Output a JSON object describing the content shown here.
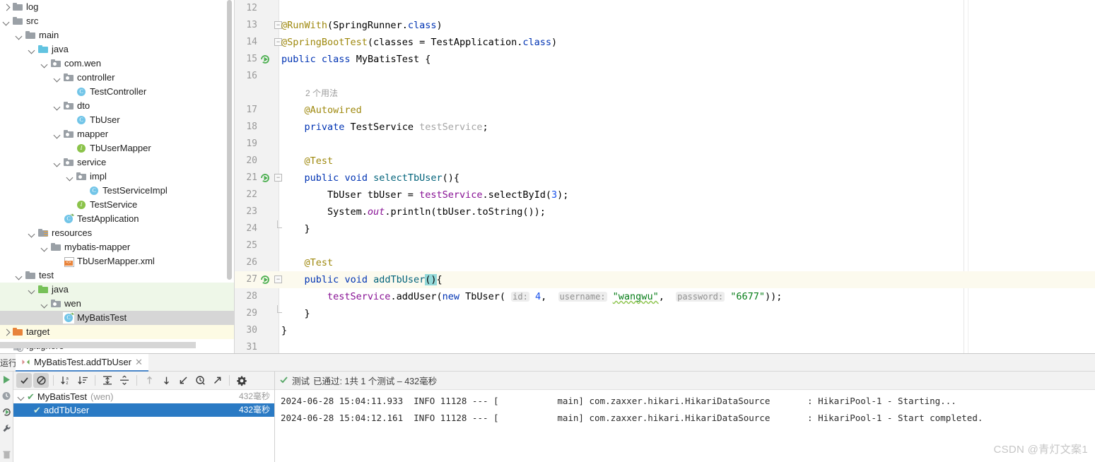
{
  "project_tree": {
    "items": [
      {
        "label": "log",
        "indent": 0,
        "twisty": "right",
        "icon": "folder",
        "tint": "none"
      },
      {
        "label": "src",
        "indent": 0,
        "twisty": "down",
        "icon": "folder",
        "tint": "none"
      },
      {
        "label": "main",
        "indent": 1,
        "twisty": "down",
        "icon": "folder",
        "tint": "none"
      },
      {
        "label": "java",
        "indent": 2,
        "twisty": "down",
        "icon": "folder-blue",
        "tint": "none"
      },
      {
        "label": "com.wen",
        "indent": 3,
        "twisty": "down",
        "icon": "pkg",
        "tint": "none"
      },
      {
        "label": "controller",
        "indent": 4,
        "twisty": "down",
        "icon": "pkg",
        "tint": "none"
      },
      {
        "label": "TestController",
        "indent": 5,
        "twisty": "none",
        "icon": "class",
        "tint": "none"
      },
      {
        "label": "dto",
        "indent": 4,
        "twisty": "down",
        "icon": "pkg",
        "tint": "none"
      },
      {
        "label": "TbUser",
        "indent": 5,
        "twisty": "none",
        "icon": "class",
        "tint": "none"
      },
      {
        "label": "mapper",
        "indent": 4,
        "twisty": "down",
        "icon": "pkg",
        "tint": "none"
      },
      {
        "label": "TbUserMapper",
        "indent": 5,
        "twisty": "none",
        "icon": "interface",
        "tint": "none"
      },
      {
        "label": "service",
        "indent": 4,
        "twisty": "down",
        "icon": "pkg",
        "tint": "none"
      },
      {
        "label": "impl",
        "indent": 5,
        "twisty": "down",
        "icon": "pkg",
        "tint": "none"
      },
      {
        "label": "TestServiceImpl",
        "indent": 6,
        "twisty": "none",
        "icon": "class",
        "tint": "none"
      },
      {
        "label": "TestService",
        "indent": 5,
        "twisty": "none",
        "icon": "interface",
        "tint": "none"
      },
      {
        "label": "TestApplication",
        "indent": 4,
        "twisty": "none",
        "icon": "class-spring",
        "tint": "none"
      },
      {
        "label": "resources",
        "indent": 2,
        "twisty": "down",
        "icon": "folder-res",
        "tint": "none"
      },
      {
        "label": "mybatis-mapper",
        "indent": 3,
        "twisty": "down",
        "icon": "folder",
        "tint": "none"
      },
      {
        "label": "TbUserMapper.xml",
        "indent": 4,
        "twisty": "none",
        "icon": "xml",
        "tint": "none"
      },
      {
        "label": "test",
        "indent": 1,
        "twisty": "down",
        "icon": "folder",
        "tint": "none"
      },
      {
        "label": "java",
        "indent": 2,
        "twisty": "down",
        "icon": "folder-green",
        "tint": "green"
      },
      {
        "label": "wen",
        "indent": 3,
        "twisty": "down",
        "icon": "pkg",
        "tint": "green"
      },
      {
        "label": "MyBatisTest",
        "indent": 4,
        "twisty": "none",
        "icon": "class-spring",
        "tint": "selected"
      },
      {
        "label": "target",
        "indent": 0,
        "twisty": "right",
        "icon": "folder-orange",
        "tint": "yellow"
      },
      {
        "label": ".gitignore",
        "indent": 0,
        "twisty": "none",
        "icon": "git",
        "tint": "none"
      }
    ]
  },
  "editor": {
    "lines": [
      {
        "num": "12",
        "segments": []
      },
      {
        "num": "13",
        "fold": "open",
        "segments": [
          {
            "t": "@RunWith",
            "c": "anno"
          },
          {
            "t": "(SpringRunner.",
            "c": "typ"
          },
          {
            "t": "class",
            "c": "cls-ref"
          },
          {
            "t": ")",
            "c": "typ"
          }
        ]
      },
      {
        "num": "14",
        "fold": "open",
        "segments": [
          {
            "t": "@SpringBootTest",
            "c": "anno"
          },
          {
            "t": "(classes = TestApplication.",
            "c": "typ"
          },
          {
            "t": "class",
            "c": "cls-ref"
          },
          {
            "t": ")",
            "c": "typ"
          }
        ]
      },
      {
        "num": "15",
        "run": true,
        "segments": [
          {
            "t": "public",
            "c": "kw"
          },
          {
            "t": " ",
            "c": "typ"
          },
          {
            "t": "class",
            "c": "kw"
          },
          {
            "t": " MyBatisTest {",
            "c": "typ"
          }
        ]
      },
      {
        "num": "16",
        "segments": []
      },
      {
        "num": "",
        "usage": "2 个用法"
      },
      {
        "num": "17",
        "segments": [
          {
            "t": "    @Autowired",
            "c": "anno"
          }
        ]
      },
      {
        "num": "18",
        "segments": [
          {
            "t": "    ",
            "c": "typ"
          },
          {
            "t": "private",
            "c": "kw"
          },
          {
            "t": " TestService ",
            "c": "typ"
          },
          {
            "t": "testService",
            "c": "grey"
          },
          {
            "t": ";",
            "c": "typ"
          }
        ]
      },
      {
        "num": "19",
        "segments": []
      },
      {
        "num": "20",
        "segments": [
          {
            "t": "    @Test",
            "c": "anno"
          }
        ]
      },
      {
        "num": "21",
        "run": true,
        "fold": "open",
        "segments": [
          {
            "t": "    ",
            "c": "typ"
          },
          {
            "t": "public",
            "c": "kw"
          },
          {
            "t": " ",
            "c": "typ"
          },
          {
            "t": "void",
            "c": "kw"
          },
          {
            "t": " ",
            "c": "typ"
          },
          {
            "t": "selectTbUser",
            "c": "meth"
          },
          {
            "t": "(){",
            "c": "typ"
          }
        ]
      },
      {
        "num": "22",
        "segments": [
          {
            "t": "        TbUser tbUser = ",
            "c": "typ"
          },
          {
            "t": "testService",
            "c": "field"
          },
          {
            "t": ".selectById(",
            "c": "typ"
          },
          {
            "t": "3",
            "c": "num"
          },
          {
            "t": ");",
            "c": "typ"
          }
        ]
      },
      {
        "num": "23",
        "segments": [
          {
            "t": "        System.",
            "c": "typ"
          },
          {
            "t": "out",
            "c": "stat"
          },
          {
            "t": ".println(tbUser.toString());",
            "c": "typ"
          }
        ]
      },
      {
        "num": "24",
        "fold": "close",
        "segments": [
          {
            "t": "    }",
            "c": "typ"
          }
        ]
      },
      {
        "num": "25",
        "segments": []
      },
      {
        "num": "26",
        "segments": [
          {
            "t": "    @Test",
            "c": "anno"
          }
        ]
      },
      {
        "num": "27",
        "run": true,
        "fold": "open",
        "highlight": true,
        "segments": [
          {
            "t": "    ",
            "c": "typ"
          },
          {
            "t": "public",
            "c": "kw"
          },
          {
            "t": " ",
            "c": "typ"
          },
          {
            "t": "void",
            "c": "kw"
          },
          {
            "t": " ",
            "c": "typ"
          },
          {
            "t": "addTbUser",
            "c": "meth"
          },
          {
            "t": "()",
            "c": "paren-hl"
          },
          {
            "t": "{",
            "c": "typ"
          }
        ]
      },
      {
        "num": "28",
        "segments": [
          {
            "t": "        ",
            "c": "typ"
          },
          {
            "t": "testService",
            "c": "field"
          },
          {
            "t": ".addUser(",
            "c": "typ"
          },
          {
            "t": "new",
            "c": "kw"
          },
          {
            "t": " TbUser( ",
            "c": "typ"
          },
          {
            "t": "id:",
            "c": "hint"
          },
          {
            "t": " ",
            "c": "typ"
          },
          {
            "t": "4",
            "c": "num"
          },
          {
            "t": ",  ",
            "c": "typ"
          },
          {
            "t": "username:",
            "c": "hint"
          },
          {
            "t": " ",
            "c": "typ"
          },
          {
            "t": "\"wangwu\"",
            "c": "str wavy"
          },
          {
            "t": ",  ",
            "c": "typ"
          },
          {
            "t": "password:",
            "c": "hint"
          },
          {
            "t": " ",
            "c": "typ"
          },
          {
            "t": "\"6677\"",
            "c": "str"
          },
          {
            "t": "));",
            "c": "typ"
          }
        ]
      },
      {
        "num": "29",
        "fold": "close",
        "segments": [
          {
            "t": "    }",
            "c": "typ"
          }
        ]
      },
      {
        "num": "30",
        "segments": [
          {
            "t": "}",
            "c": "typ"
          }
        ]
      },
      {
        "num": "31",
        "segments": []
      }
    ]
  },
  "run_window": {
    "label": "运行:",
    "tab": {
      "title": "MyBatisTest.addTbUser",
      "close": "✕"
    },
    "toolbar": [
      {
        "name": "show-passed-toggle",
        "glyph": "✔",
        "active": true
      },
      {
        "name": "show-ignored-toggle",
        "glyph": "⊘",
        "active": true
      },
      {
        "name": "sort-alphabetically",
        "glyph": "↓a",
        "active": false
      },
      {
        "name": "sort-by-duration",
        "glyph": "↓≡",
        "active": false
      },
      {
        "name": "expand-all",
        "glyph": "⤒",
        "active": false
      },
      {
        "name": "collapse-all",
        "glyph": "⤓",
        "active": false
      },
      {
        "name": "previous-failed-test",
        "glyph": "↑",
        "active": false
      },
      {
        "name": "next-failed-test",
        "glyph": "↓",
        "active": false
      },
      {
        "name": "rerun-failed-tests",
        "glyph": "↙",
        "active": false
      },
      {
        "name": "test-history",
        "glyph": "🕐",
        "active": false
      },
      {
        "name": "export-test-results",
        "glyph": "↗",
        "active": false
      },
      {
        "name": "test-settings",
        "glyph": "⚙",
        "active": false
      }
    ],
    "tests": [
      {
        "label": "MyBatisTest",
        "suffix": "(wen)",
        "duration": "432毫秒",
        "selected": false,
        "indent": 0,
        "expanded": true
      },
      {
        "label": "addTbUser",
        "suffix": "",
        "duration": "432毫秒",
        "selected": true,
        "indent": 1,
        "expanded": false
      }
    ],
    "status": {
      "prefix": "测试",
      "text": "已通过: 1共 1 个测试 – 432毫秒"
    },
    "console": [
      "2024-06-28 15:04:11.933  INFO 11128 --- [           main] com.zaxxer.hikari.HikariDataSource       : HikariPool-1 - Starting...",
      "2024-06-28 15:04:12.161  INFO 11128 --- [           main] com.zaxxer.hikari.HikariDataSource       : HikariPool-1 - Start completed."
    ],
    "rail": [
      {
        "name": "rerun-button",
        "glyph": "▶"
      },
      {
        "name": "rerun-debug-button",
        "glyph": "⏱"
      },
      {
        "name": "rerun-tests-button",
        "glyph": "▶"
      },
      {
        "name": "settings-button",
        "glyph": "🔧"
      },
      {
        "name": "delete-button",
        "glyph": "🗑"
      }
    ]
  },
  "watermark": "CSDN @青灯文案1",
  "colors": {
    "accent_blue": "#2a7ac4",
    "tab_underline": "#4a86c8",
    "test_pass_green": "#59a869",
    "source_root_green": "#eef7e8",
    "excluded_yellow": "#fdfbe4",
    "selection_gray": "#d6d6d6",
    "keyword_blue": "#0033b3",
    "annotation_gold": "#9e880d",
    "string_green": "#067d17",
    "number_blue": "#1750eb",
    "field_purple": "#871094",
    "method_teal": "#00627a",
    "current_line": "#fcfaee"
  }
}
